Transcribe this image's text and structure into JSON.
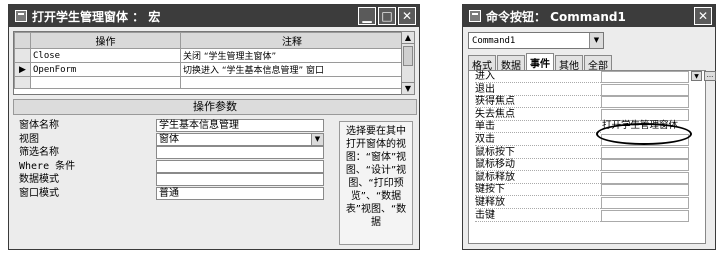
{
  "macro_window": {
    "title": "打开学生管理窗体 ： 宏",
    "columns": [
      "操作",
      "注释"
    ],
    "rows": [
      {
        "selector": "",
        "action": "Close",
        "comment": "关闭 “学生管理主窗体”"
      },
      {
        "selector": "▶",
        "action": "OpenForm",
        "comment": "切换进入 “学生基本信息管理” 窗口"
      },
      {
        "selector": "",
        "action": "",
        "comment": ""
      }
    ],
    "params_header": "操作参数",
    "params": [
      {
        "label": "窗体名称",
        "value": "学生基本信息管理"
      },
      {
        "label": "视图",
        "value": "窗体"
      },
      {
        "label": "筛选名称",
        "value": ""
      },
      {
        "label": "Where 条件",
        "value": ""
      },
      {
        "label": "数据模式",
        "value": ""
      },
      {
        "label": "窗口模式",
        "value": "普通"
      }
    ],
    "help_text": "选择要在其中打开窗体的视图：“窗体”视图、“设计”视图、“打印预览”、“数据表”视图、“数据"
  },
  "props_window": {
    "title": "命令按钮： Command1",
    "object": "Command1",
    "tabs": [
      "格式",
      "数据",
      "事件",
      "其他",
      "全部"
    ],
    "active_tab": "事件",
    "properties": [
      {
        "name": "进入",
        "value": ""
      },
      {
        "name": "退出",
        "value": ""
      },
      {
        "name": "获得焦点",
        "value": ""
      },
      {
        "name": "失去焦点",
        "value": ""
      },
      {
        "name": "单击",
        "value": "打开学生管理窗体"
      },
      {
        "name": "双击",
        "value": ""
      },
      {
        "name": "鼠标按下",
        "value": ""
      },
      {
        "name": "鼠标移动",
        "value": ""
      },
      {
        "name": "鼠标释放",
        "value": ""
      },
      {
        "name": "键按下",
        "value": ""
      },
      {
        "name": "键释放",
        "value": ""
      },
      {
        "name": "击键",
        "value": ""
      }
    ]
  },
  "colors": {
    "titlebar": "#3c3c3c",
    "window_bg": "#ececec"
  }
}
